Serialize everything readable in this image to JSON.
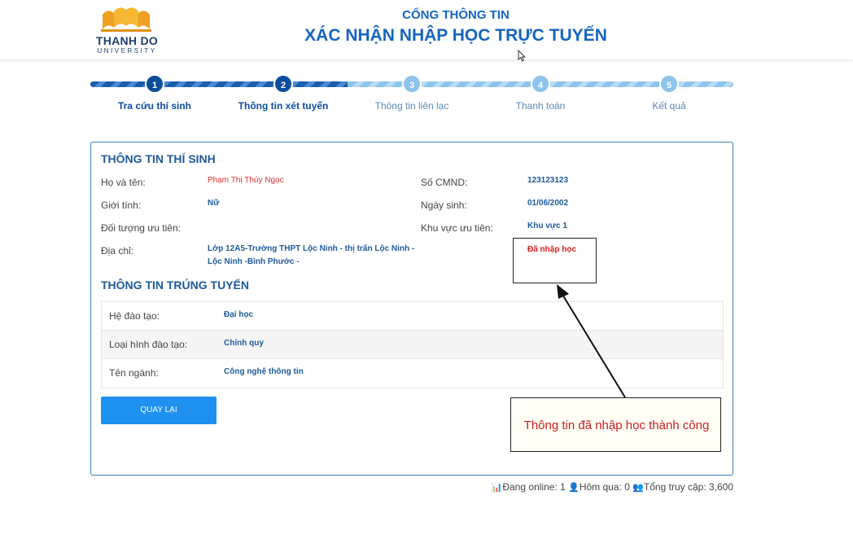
{
  "header": {
    "logo_name": "THANH DO",
    "logo_sub": "UNIVERSITY",
    "portal_title": "CỔNG THÔNG TIN",
    "portal_subtitle": "XÁC NHẬN NHẬP HỌC TRỰC TUYẾN"
  },
  "steps": [
    {
      "number": "1",
      "label": "Tra cứu thí sinh",
      "state": "done"
    },
    {
      "number": "2",
      "label": "Thông tin xét tuyển",
      "state": "done"
    },
    {
      "number": "3",
      "label": "Thông tin liên lạc",
      "state": "todo"
    },
    {
      "number": "4",
      "label": "Thanh toán",
      "state": "todo"
    },
    {
      "number": "5",
      "label": "Kết quả",
      "state": "todo"
    }
  ],
  "candidate": {
    "section_title": "THÔNG TIN THÍ SINH",
    "name_label": "Họ và tên:",
    "name_value": "Phạm Thị Thúy Ngọc",
    "id_label": "Số CMND:",
    "id_value": "123123123",
    "gender_label": "Giới tính:",
    "gender_value": "Nữ",
    "dob_label": "Ngày sinh:",
    "dob_value": "01/06/2002",
    "priority_group_label": "Đối tượng ưu tiên:",
    "priority_area_label": "Khu vực ưu tiên:",
    "priority_area_value": "Khu vực 1",
    "address_label": "Địa chỉ:",
    "address_line1": "Lớp 12A5-Trường THPT Lộc Ninh - thị trấn Lộc Ninh -",
    "address_line2": "Lộc Ninh -Bình Phước -",
    "status_value": "Đã nhập học"
  },
  "admission": {
    "section_title": "THÔNG TIN TRÚNG TUYỂN",
    "rows": [
      {
        "label": "Hệ đào tạo:",
        "value": "Đại học"
      },
      {
        "label": "Loại hình đào tạo:",
        "value": "Chính quy"
      },
      {
        "label": "Tên ngành:",
        "value": "Công nghệ thông tin"
      }
    ]
  },
  "back_button_label": "QUAY LẠI",
  "annotation_text": "Thông tin đã nhập học thành công",
  "stats": {
    "online": "Đang online: 1",
    "yesterday": "Hôm qua: 0",
    "total": "Tổng truy cập: 3,600"
  },
  "colors": {
    "brand_blue": "#1565c0",
    "status_red": "#d62020",
    "button_blue": "#1e90f0",
    "logo_gold": "#f0a020"
  },
  "icons": {
    "chart": "bar-chart-icon",
    "user": "user-icon",
    "users": "users-icon",
    "logo": "book-crown-logo-icon"
  }
}
